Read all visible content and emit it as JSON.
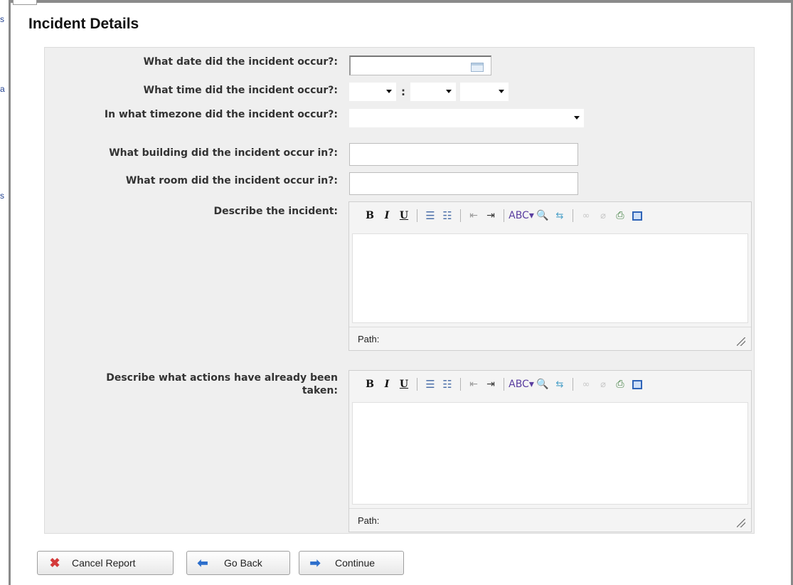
{
  "section": {
    "title": "Incident Details"
  },
  "left_fragments": [
    "s",
    "a",
    "s"
  ],
  "fields": {
    "date": {
      "label": "What date did the incident occur?:",
      "value": ""
    },
    "time": {
      "label": "What time did the incident occur?:",
      "hour": "",
      "minute": "",
      "ampm": "",
      "separator": ":"
    },
    "timezone": {
      "label": "In what timezone did the incident occur?:",
      "value": ""
    },
    "building": {
      "label": "What building did the incident occur in?:",
      "value": ""
    },
    "room": {
      "label": "What room did the incident occur in?:",
      "value": ""
    },
    "describe": {
      "label": "Describe the incident:",
      "path_label": "Path:"
    },
    "actions": {
      "label": "Describe what actions have already been taken:",
      "path_label": "Path:"
    }
  },
  "toolbar": {
    "bold": "B",
    "italic": "I",
    "underline": "U",
    "bullet_list": "☰",
    "numbered_list": "☷",
    "outdent": "⇤",
    "indent": "⇥",
    "spellcheck": "ABC▾",
    "find": "🔍",
    "replace": "⇆",
    "link": "∞",
    "unlink": "⌀",
    "print": "⎙"
  },
  "buttons": {
    "cancel": "Cancel Report",
    "back": "Go Back",
    "continue": "Continue"
  },
  "colors": {
    "panel": "#efefef",
    "cancel_icon": "#d43a3a",
    "arrow_icon": "#2d6fcc"
  }
}
